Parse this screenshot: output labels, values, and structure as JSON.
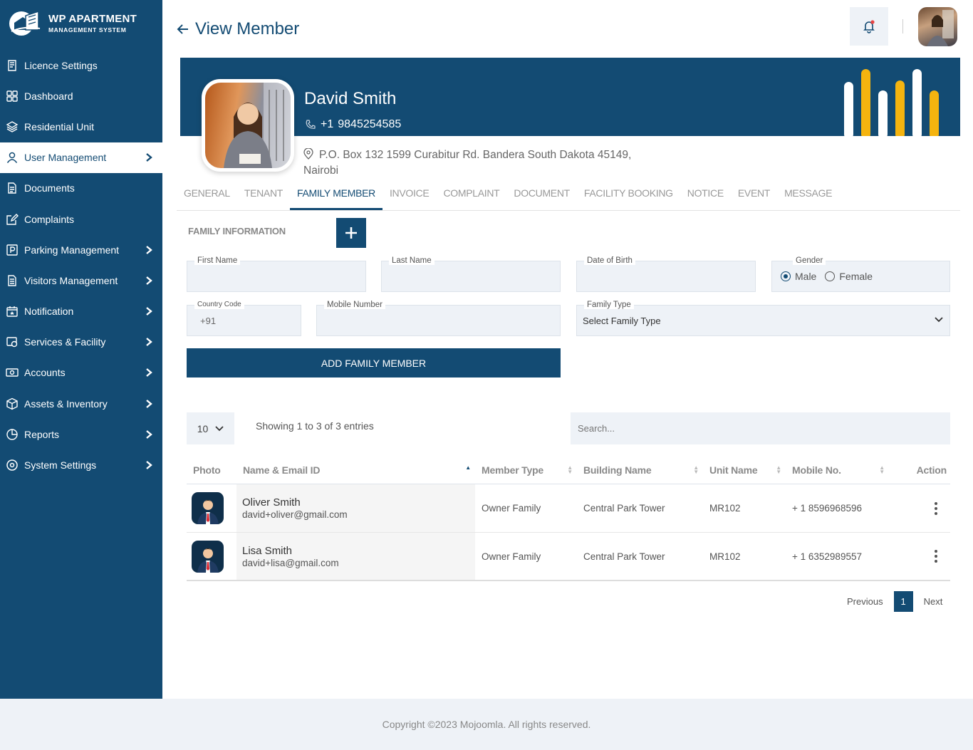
{
  "app": {
    "logo_line1": "WP APARTMENT",
    "logo_line2": "MANAGEMENT SYSTEM"
  },
  "sidebar": {
    "items": [
      {
        "label": "Licence Settings",
        "icon": "licence-icon",
        "has_chevron": false,
        "active": false
      },
      {
        "label": "Dashboard",
        "icon": "dashboard-icon",
        "has_chevron": false,
        "active": false
      },
      {
        "label": "Residential Unit",
        "icon": "layers-icon",
        "has_chevron": false,
        "active": false
      },
      {
        "label": "User Management",
        "icon": "user-icon",
        "has_chevron": true,
        "active": true
      },
      {
        "label": "Documents",
        "icon": "document-icon",
        "has_chevron": false,
        "active": false
      },
      {
        "label": "Complaints",
        "icon": "edit-icon",
        "has_chevron": false,
        "active": false
      },
      {
        "label": "Parking Management",
        "icon": "parking-icon",
        "has_chevron": true,
        "active": false
      },
      {
        "label": "Visitors Management",
        "icon": "visitor-icon",
        "has_chevron": true,
        "active": false
      },
      {
        "label": "Notification",
        "icon": "calendar-star-icon",
        "has_chevron": true,
        "active": false
      },
      {
        "label": "Services & Facility",
        "icon": "services-icon",
        "has_chevron": true,
        "active": false
      },
      {
        "label": "Accounts",
        "icon": "money-icon",
        "has_chevron": true,
        "active": false
      },
      {
        "label": "Assets & Inventory",
        "icon": "box-icon",
        "has_chevron": true,
        "active": false
      },
      {
        "label": "Reports",
        "icon": "pie-chart-icon",
        "has_chevron": true,
        "active": false
      },
      {
        "label": "System Settings",
        "icon": "settings-icon",
        "has_chevron": true,
        "active": false
      }
    ]
  },
  "header": {
    "title": "View Member"
  },
  "profile": {
    "name": "David Smith",
    "phone_code": "+1",
    "phone": "9845254585",
    "address": "P.O. Box 132 1599 Curabitur Rd. Bandera South Dakota 45149, Nairobi"
  },
  "tabs": [
    {
      "label": "GENERAL",
      "active": false
    },
    {
      "label": "TENANT",
      "active": false
    },
    {
      "label": "FAMILY MEMBER",
      "active": true
    },
    {
      "label": "INVOICE",
      "active": false
    },
    {
      "label": "COMPLAINT",
      "active": false
    },
    {
      "label": "DOCUMENT",
      "active": false
    },
    {
      "label": "FACILITY BOOKING",
      "active": false
    },
    {
      "label": "NOTICE",
      "active": false
    },
    {
      "label": "EVENT",
      "active": false
    },
    {
      "label": "MESSAGE",
      "active": false
    }
  ],
  "form": {
    "section_title": "FAMILY INFORMATION",
    "first_name_label": "First Name",
    "last_name_label": "Last Name",
    "dob_label": "Date of Birth",
    "gender_label": "Gender",
    "gender_male": "Male",
    "gender_female": "Female",
    "gender_selected": "Male",
    "country_code_label": "Country Code",
    "country_code_value": "+91",
    "mobile_label": "Mobile Number",
    "family_type_label": "Family Type",
    "family_type_value": "Select Family Type",
    "submit_label": "ADD FAMILY MEMBER"
  },
  "table": {
    "page_length": "10",
    "showing_text": "Showing 1 to 3 of 3 entries",
    "search_placeholder": "Search...",
    "columns": [
      "Photo",
      "Name & Email ID",
      "Member Type",
      "Building Name",
      "Unit Name",
      "Mobile No.",
      "Action"
    ],
    "rows": [
      {
        "name": "Oliver Smith",
        "email": "david+oliver@gmail.com",
        "member_type": "Owner Family",
        "building": "Central Park Tower",
        "unit": "MR102",
        "mobile": "+ 1 8596968596"
      },
      {
        "name": "Lisa Smith",
        "email": "david+lisa@gmail.com",
        "member_type": "Owner Family",
        "building": "Central Park Tower",
        "unit": "MR102",
        "mobile": "+ 1 6352989557"
      }
    ]
  },
  "pagination": {
    "previous": "Previous",
    "current": "1",
    "next": "Next"
  },
  "footer": {
    "copyright": "Copyright ©2023 Mojoomla. All rights reserved."
  },
  "colors": {
    "primary": "#134b73",
    "accent": "#f5b40f",
    "field_bg": "#eef2f7"
  }
}
